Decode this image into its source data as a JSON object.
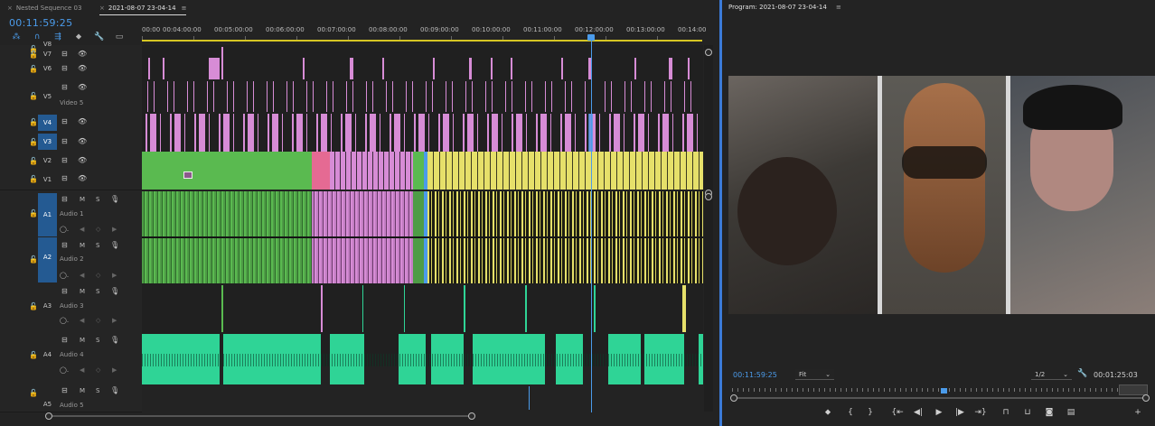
{
  "colors": {
    "accent": "#4b9bea",
    "clip_pink": "#d78cd6",
    "clip_green": "#5aba50",
    "clip_yellow": "#e6e06a",
    "audio_teal": "#2fd496",
    "work_area": "#d6c623"
  },
  "timeline": {
    "tabs": [
      {
        "close": "×",
        "label": "Nested Sequence 03"
      },
      {
        "close": "×",
        "label": "2021-08-07 23-04-14",
        "menu": "≡"
      }
    ],
    "timecode": "00:11:59:25",
    "ruler_labels": [
      "00:00",
      "00:04:00:00",
      "00:05:00:00",
      "00:06:00:00",
      "00:07:00:00",
      "00:08:00:00",
      "00:09:00:00",
      "00:10:00:00",
      "00:11:00:00",
      "00:12:00:00",
      "00:13:00:00",
      "00:14:00"
    ],
    "video_tracks": [
      {
        "id": "V8",
        "sub": ""
      },
      {
        "id": "V7",
        "sub": ""
      },
      {
        "id": "V6",
        "sub": ""
      },
      {
        "id": "V5",
        "sub": "Video 5"
      },
      {
        "id": "V4",
        "sub": ""
      },
      {
        "id": "V3",
        "sub": ""
      },
      {
        "id": "V2",
        "sub": ""
      },
      {
        "id": "V1",
        "sub": ""
      }
    ],
    "audio_tracks": [
      {
        "id": "A1",
        "sub": "Audio 1",
        "m": "M",
        "s": "S"
      },
      {
        "id": "A2",
        "sub": "Audio 2",
        "m": "M",
        "s": "S"
      },
      {
        "id": "A3",
        "sub": "Audio 3",
        "m": "M",
        "s": "S"
      },
      {
        "id": "A4",
        "sub": "Audio 4",
        "m": "M",
        "s": "S"
      },
      {
        "id": "A5",
        "sub": "Audio 5",
        "m": "M",
        "s": "S"
      }
    ],
    "vol_value": "0.0"
  },
  "program": {
    "title": "Program: 2021-08-07 23-04-14",
    "menu": "≡",
    "timecode": "00:11:59:25",
    "fit": "Fit",
    "resolution": "1/2",
    "duration": "00:01:25:03"
  }
}
